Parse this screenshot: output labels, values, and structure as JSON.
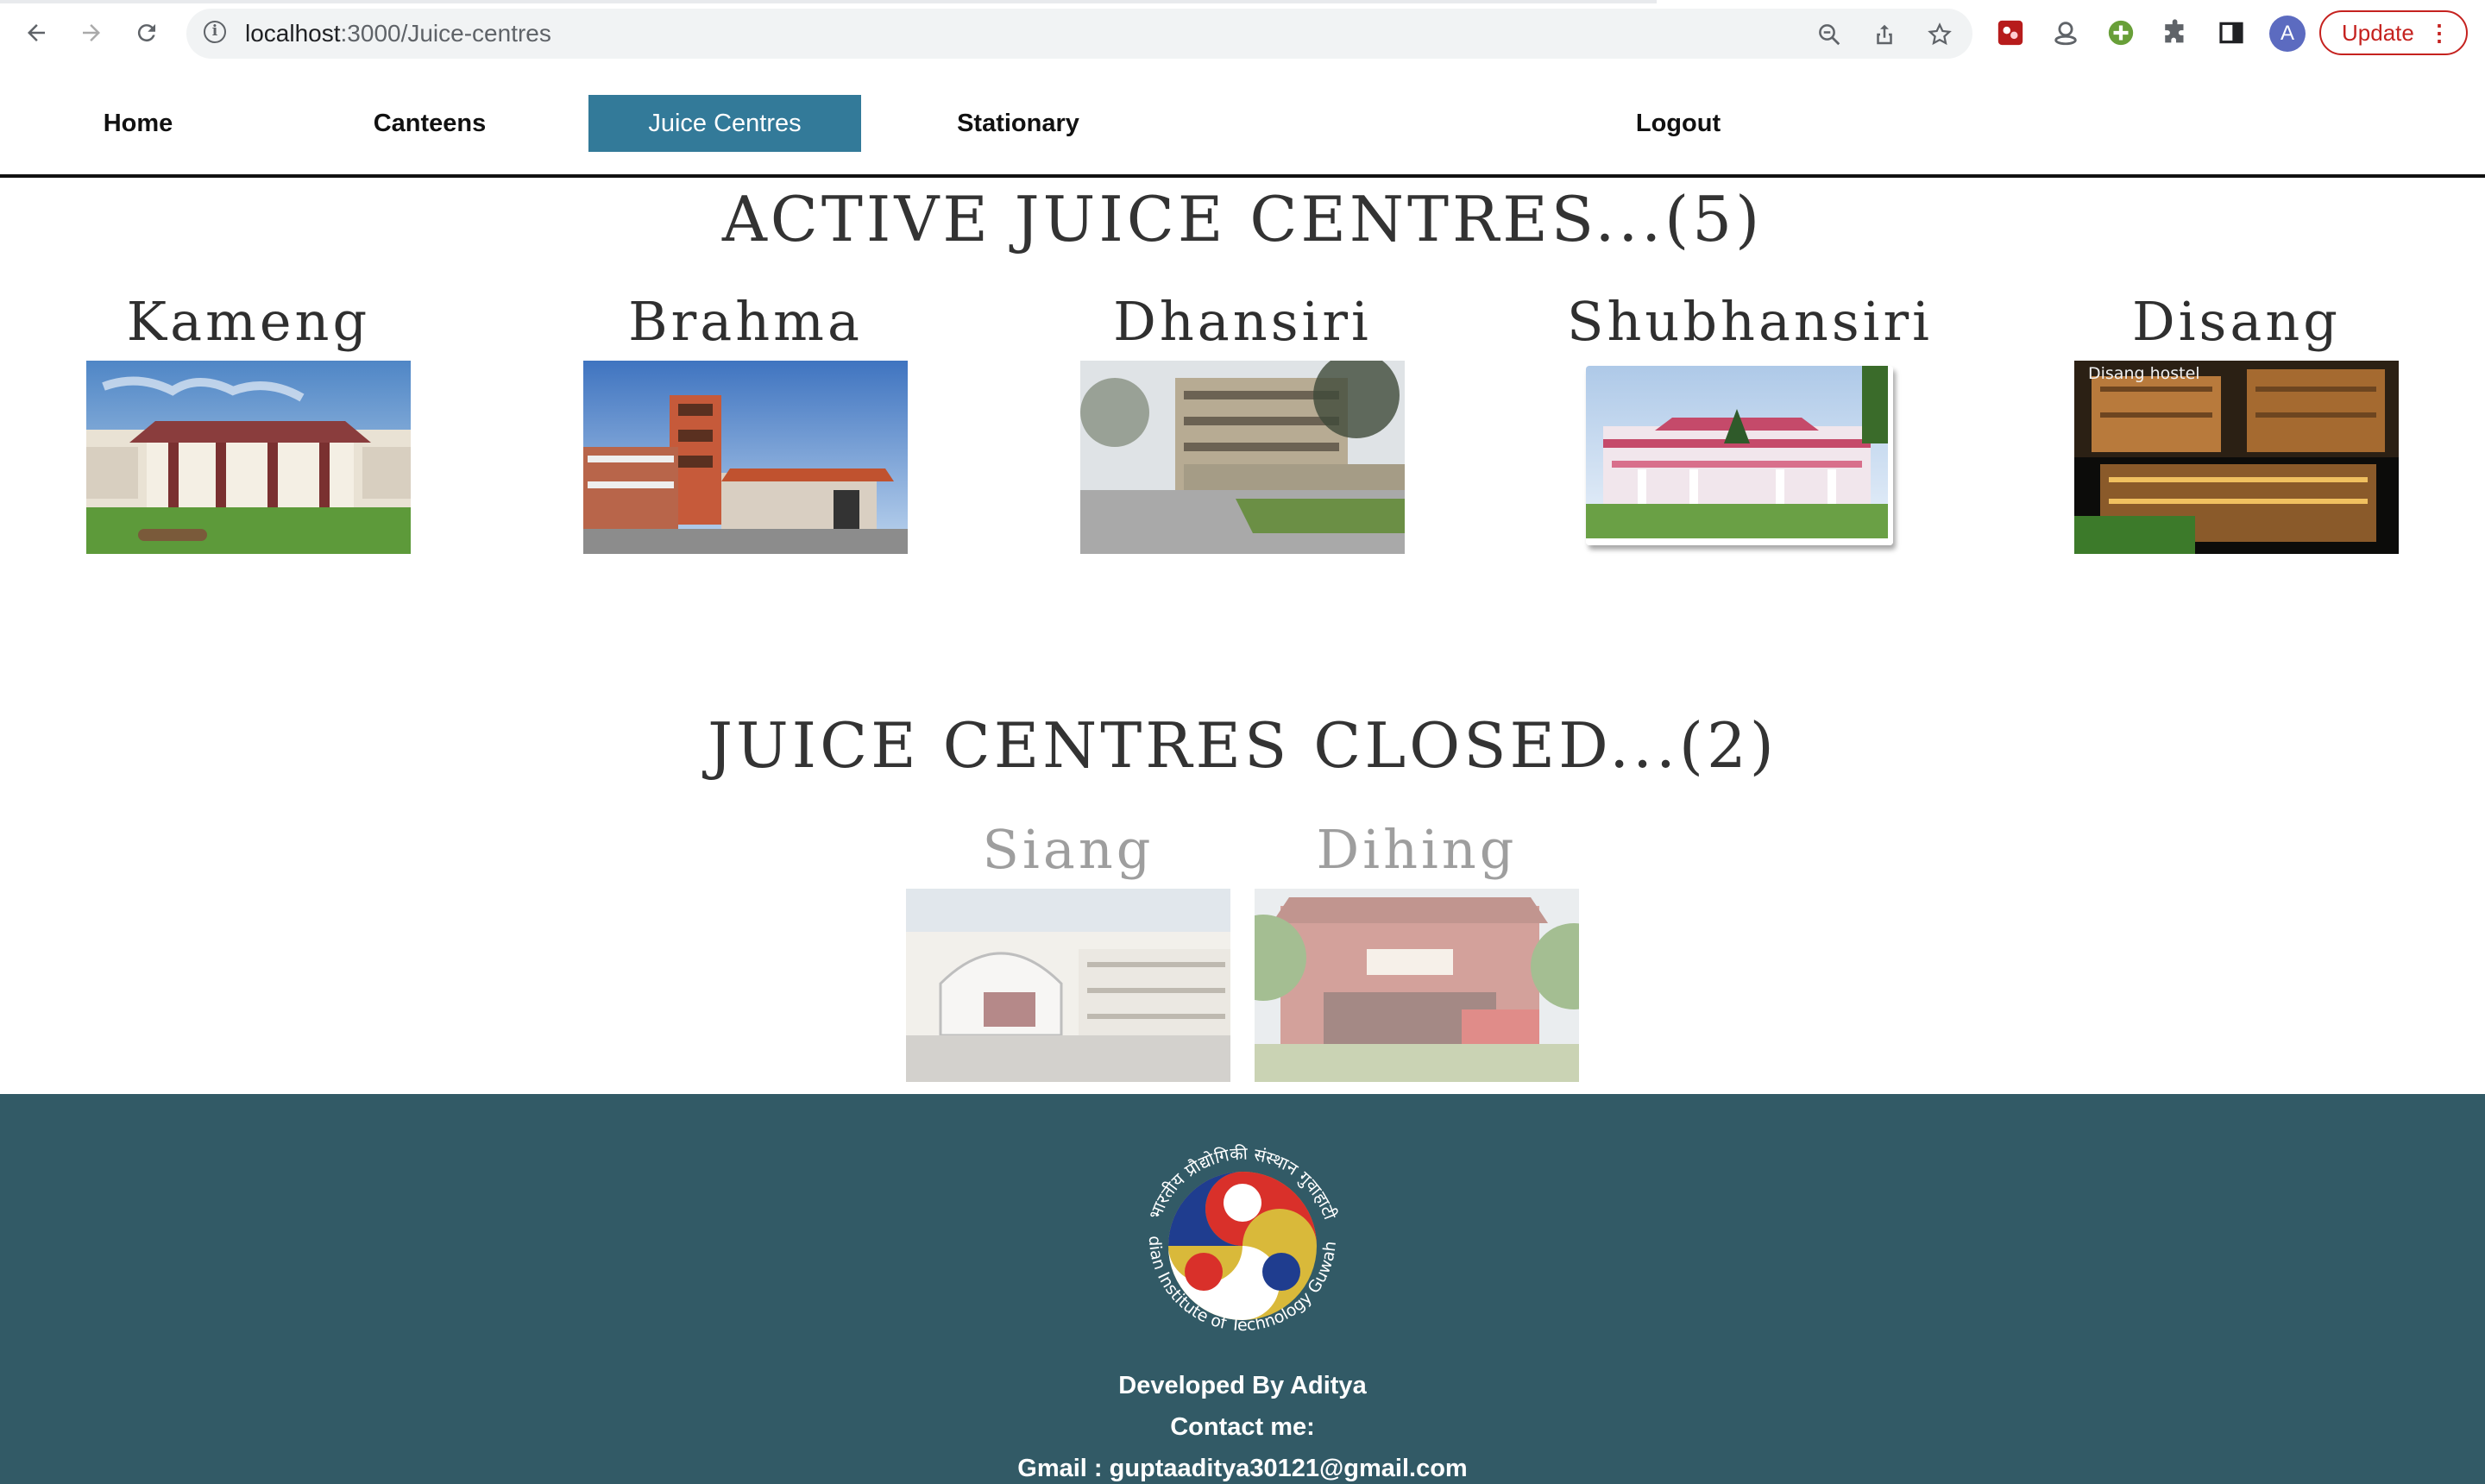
{
  "browser": {
    "url_host": "localhost",
    "url_path": ":3000/Juice-centres",
    "update_label": "Update",
    "avatar_letter": "A"
  },
  "nav": {
    "items": [
      {
        "label": "Home",
        "active": false
      },
      {
        "label": "Canteens",
        "active": false
      },
      {
        "label": "Juice Centres",
        "active": true
      },
      {
        "label": "Stationary",
        "active": false
      }
    ],
    "logout_label": "Logout"
  },
  "active": {
    "title": "ACTIVE JUICE CENTRES...(5)",
    "centres": [
      {
        "name": "Kameng"
      },
      {
        "name": "Brahma"
      },
      {
        "name": "Dhansiri"
      },
      {
        "name": "Shubhansiri"
      },
      {
        "name": "Disang",
        "image_caption": "Disang hostel"
      }
    ]
  },
  "closed": {
    "title": "JUICE CENTRES CLOSED...(2)",
    "centres": [
      {
        "name": "Siang"
      },
      {
        "name": "Dihing"
      }
    ]
  },
  "footer": {
    "logo_text_top": "भारतीय प्रौद्योगिकी संस्थान गुवाहाटी",
    "logo_text_bottom": "Indian Institute of Technology Guwahati",
    "developed_by": "Developed By Aditya",
    "contact_label": "Contact me:",
    "gmail": "Gmail : guptaaditya30121@gmail.com"
  },
  "colors": {
    "nav_active_bg": "#337a99",
    "footer_bg": "#325a66",
    "update_red": "#c5221f"
  }
}
